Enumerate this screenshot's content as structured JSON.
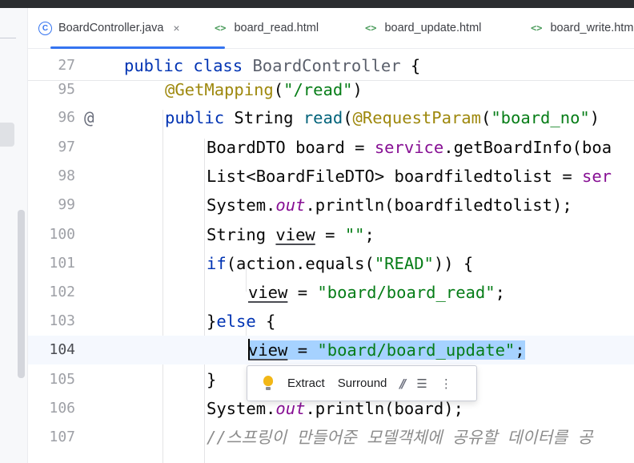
{
  "tabs": [
    {
      "label": "BoardController.java",
      "icon": "class-icon",
      "active": true,
      "close": "×"
    },
    {
      "label": "board_read.html",
      "icon": "html-icon",
      "icon_glyph": "<>"
    },
    {
      "label": "board_update.html",
      "icon": "html-icon",
      "icon_glyph": "<>"
    },
    {
      "label": "board_write.html",
      "icon": "html-icon",
      "icon_glyph": "<>"
    }
  ],
  "active_tab_icon_glyph": "C",
  "editor": {
    "current_line": 104,
    "lines": [
      {
        "n": "27",
        "text": "public class BoardController {"
      },
      {
        "n": "95",
        "text": "@GetMapping(\"/read\")"
      },
      {
        "n": "96",
        "text": "public String read(@RequestParam(\"board_no\")",
        "gutter": "@"
      },
      {
        "n": "97",
        "text": "BoardDTO board = service.getBoardInfo(boa"
      },
      {
        "n": "98",
        "text": "List<BoardFileDTO> boardfiledtolist = ser"
      },
      {
        "n": "99",
        "text": "System.out.println(boardfiledtolist);"
      },
      {
        "n": "100",
        "text": "String view = \"\";"
      },
      {
        "n": "101",
        "text": "if(action.equals(\"READ\")) {"
      },
      {
        "n": "102",
        "text": "view = \"board/board_read\";"
      },
      {
        "n": "103",
        "text": "}else {"
      },
      {
        "n": "104",
        "text": "view = \"board/board_update\";"
      },
      {
        "n": "105",
        "text": "}"
      },
      {
        "n": "106",
        "text": "System.out.println(board);"
      },
      {
        "n": "107",
        "text": "//스프링이 만들어준 모델객체에 공유할 데이터를 공"
      }
    ]
  },
  "intention_popup": {
    "bulb_icon": "lightbulb-icon",
    "extract_label": "Extract",
    "surround_label": "Surround",
    "comment_glyph": "//",
    "reformat_glyph": "☰",
    "more_glyph": "⋮"
  },
  "colors": {
    "keyword": "#0033b3",
    "annotation": "#9e880d",
    "string": "#067d17",
    "field": "#871094",
    "selection": "#a6d2ff",
    "accent": "#3574f0"
  }
}
